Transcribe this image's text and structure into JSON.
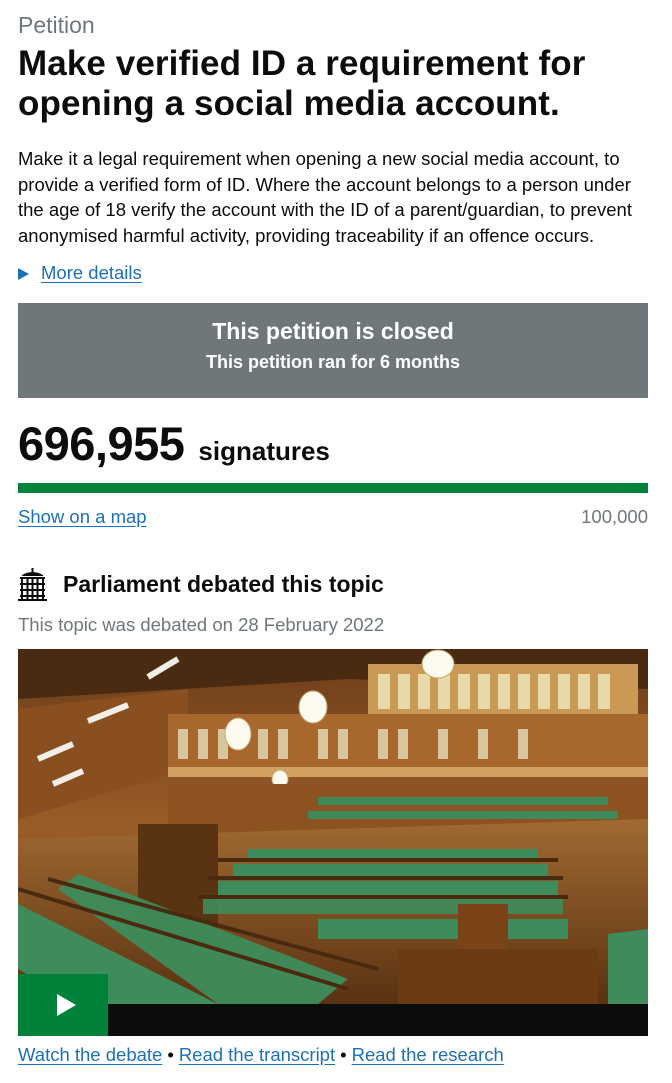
{
  "petition": {
    "eyebrow": "Petition",
    "title": "Make verified ID a requirement for opening a social media account.",
    "summary": "Make it a legal requirement when opening a new social media account, to provide a verified form of ID. Where the account belongs to a person under the age of 18 verify the account with the ID of a parent/guardian, to prevent anonymised harmful activity, providing traceability if an offence occurs.",
    "more_details_label": "More details"
  },
  "status": {
    "heading": "This petition is closed",
    "subheading": "This petition ran for 6 months"
  },
  "signatures": {
    "count": "696,955",
    "label": "signatures",
    "progress_fraction": 1.0,
    "show_map_label": "Show on a map",
    "threshold": "100,000"
  },
  "debate": {
    "icon": "portcullis-icon",
    "heading": "Parliament debated this topic",
    "date_text": "This topic was debated on 28 February 2022",
    "play_icon": "play-icon",
    "links": {
      "watch": "Watch the debate",
      "transcript": "Read the transcript",
      "research": "Read the research",
      "separator": "•"
    }
  },
  "colors": {
    "link": "#1d70b8",
    "status_box": "#6f777b",
    "progress_fill": "#00823b",
    "play_button": "#00823b",
    "secondary_text": "#6f777b"
  }
}
